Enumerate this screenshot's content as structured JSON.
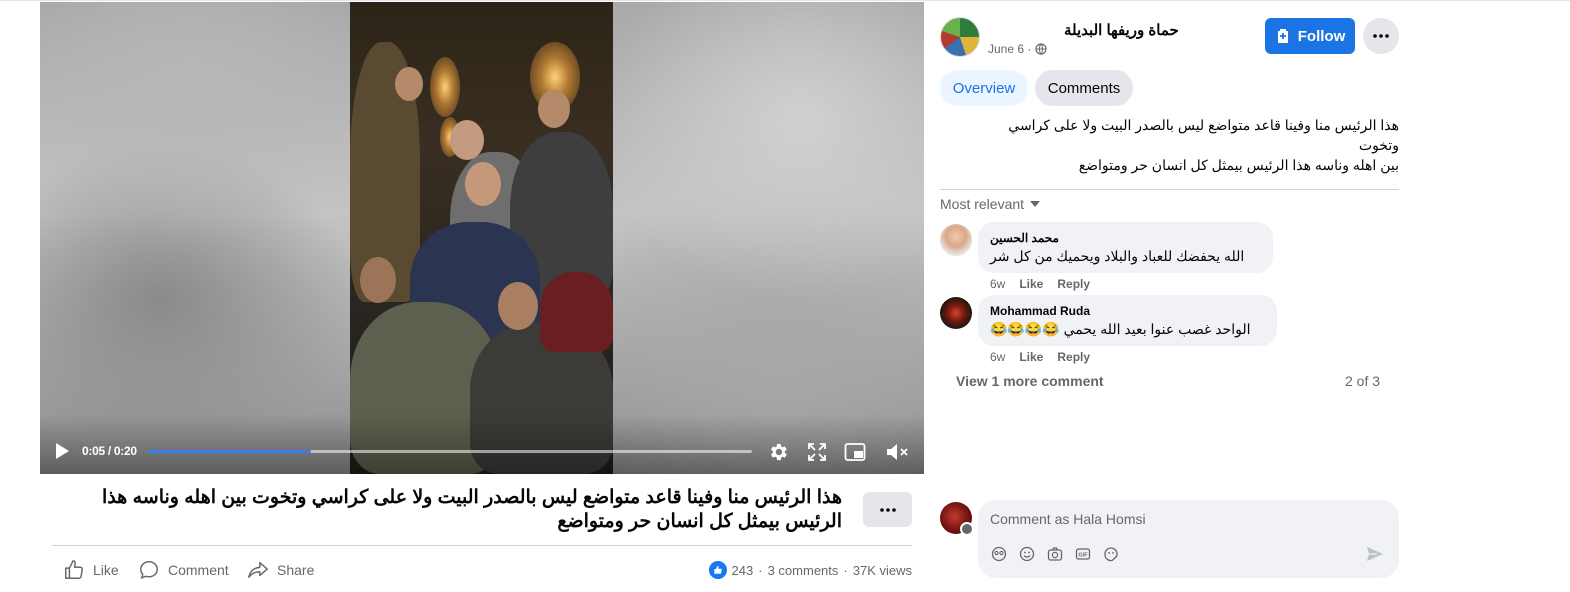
{
  "video": {
    "time": "0:05 / 0:20",
    "progress": 0.27
  },
  "post": {
    "caption": "هذا الرئيس منا وفينا قاعد متواضع ليس بالصدر البيت ولا على كراسي وتخوت بين اهله وناسه هذا الرئيس بيمثل كل انسان حر ومتواضع",
    "text_line1": "هذا الرئيس منا وفينا قاعد متواضع ليس بالصدر البيت ولا على كراسي",
    "text_line2": "وتخوت",
    "text_line3": "بين اهله وناسه هذا الرئيس بيمثل كل انسان حر ومتواضع"
  },
  "actions": {
    "like": "Like",
    "comment": "Comment",
    "share": "Share"
  },
  "stats": {
    "reactions": "243",
    "sep": "·",
    "comments": "3 comments",
    "views": "37K views"
  },
  "page": {
    "name": "حماة وريفها البديلة",
    "date": "June 6 ·",
    "follow_label": "Follow"
  },
  "tabs": [
    {
      "label": "Overview",
      "active": true
    },
    {
      "label": "Comments",
      "active": false
    }
  ],
  "comments_section": {
    "sort_label": "Most relevant",
    "view_more": "View 1 more comment",
    "pager": "2 of 3",
    "comments": [
      {
        "author": "محمد الحسين",
        "text": "الله يحفضك للعباد والبلاد ويحميك من كل شر",
        "time": "6w",
        "like": "Like",
        "reply": "Reply"
      },
      {
        "author": "Mohammad Ruda",
        "text": "الواحد غصب عنوا بعيد الله يحمي 😂😂😂😂",
        "time": "6w",
        "like": "Like",
        "reply": "Reply"
      }
    ]
  },
  "composer": {
    "placeholder": "Comment as Hala Homsi"
  },
  "colors": {
    "accent": "#1b74e4",
    "progress": "#3b7df0",
    "secondary_text": "#65676b"
  }
}
